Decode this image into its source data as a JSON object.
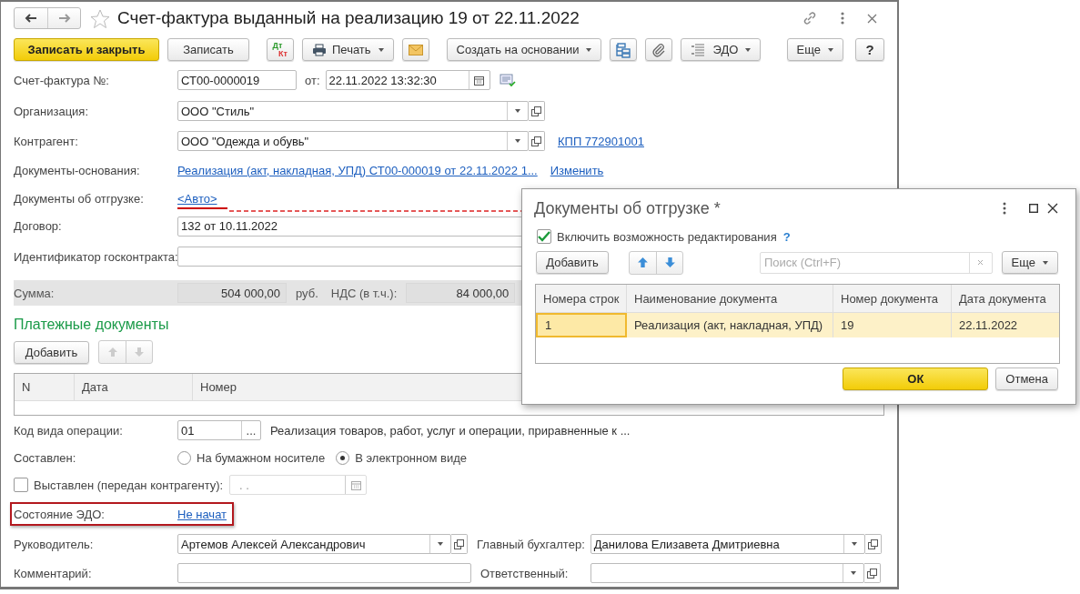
{
  "window": {
    "title": "Счет-фактура выданный на реализацию 19 от 22.11.2022"
  },
  "toolbar": {
    "save_close": "Записать и закрыть",
    "save": "Записать",
    "debit": "Дт",
    "credit": "Кт",
    "print": "Печать",
    "create_based": "Создать на основании",
    "edo": "ЭДО",
    "more": "Еще",
    "help": "?"
  },
  "invoice_number": {
    "label": "Счет-фактура №:",
    "value": "СТ00-0000019",
    "date_label": "от:",
    "date": "22.11.2022 13:32:30"
  },
  "organization": {
    "label": "Организация:",
    "value": "ООО \"Стиль\""
  },
  "counterparty": {
    "label": "Контрагент:",
    "value": "ООО \"Одежда и обувь\"",
    "link": "КПП 772901001"
  },
  "base_documents": {
    "label": "Документы-основания:",
    "link": "Реализация (акт, накладная, УПД) СТ00-000019 от 22.11.2022 1...",
    "action": "Изменить"
  },
  "shipping_documents": {
    "label": "Документы об отгрузке:",
    "link": "<Авто>",
    "highlighted": true
  },
  "contract": {
    "label": "Договор:",
    "value": "132 от 10.11.2022"
  },
  "gov_contract_id": {
    "label": "Идентификатор госконтракта:"
  },
  "totals": {
    "label": "Сумма:",
    "amount": "504 000,00",
    "currency": "руб.",
    "vat_label": "НДС (в т.ч.):",
    "vat": "84 000,00"
  },
  "payment_documents": {
    "title": "Платежные документы",
    "add": "Добавить",
    "columns": [
      "N",
      "Дата",
      "Номер"
    ]
  },
  "operation_code": {
    "label": "Код вида операции:",
    "value": "01",
    "select": "...",
    "description": "Реализация товаров, работ, услуг и операции, приравненные к ..."
  },
  "compiled": {
    "label": "Составлен:",
    "options": [
      {
        "label": "На бумажном носителе",
        "selected": false
      },
      {
        "label": "В электронном виде",
        "selected": true
      }
    ]
  },
  "issued": {
    "label": "Выставлен (передан контрагенту):",
    "checked": false,
    "date": ".  ."
  },
  "edo_status": {
    "label": "Состояние ЭДО:",
    "link": "Не начат",
    "highlighted": true
  },
  "manager": {
    "label": "Руководитель:",
    "value": "Артемов Алексей Александрович"
  },
  "chief_accountant": {
    "label": "Главный бухгалтер:",
    "value": "Данилова Елизавета Дмитриевна"
  },
  "comment": {
    "label": "Комментарий:"
  },
  "responsible": {
    "label": "Ответственный:"
  },
  "dialog": {
    "title": "Документы об отгрузке *",
    "edit_enabled": {
      "label": "Включить возможность редактирования",
      "checked": true,
      "help": "?"
    },
    "add": "Добавить",
    "search": {
      "placeholder": "Поиск (Ctrl+F)"
    },
    "more": "Еще",
    "columns": [
      "Номера строк",
      "Наименование документа",
      "Номер документа",
      "Дата документа"
    ],
    "rows": [
      {
        "cells": [
          "1",
          "Реализация (акт, накладная, УПД)",
          "19",
          "22.11.2022"
        ],
        "selected": true
      }
    ],
    "ok": "ОК",
    "cancel": "Отмена"
  }
}
